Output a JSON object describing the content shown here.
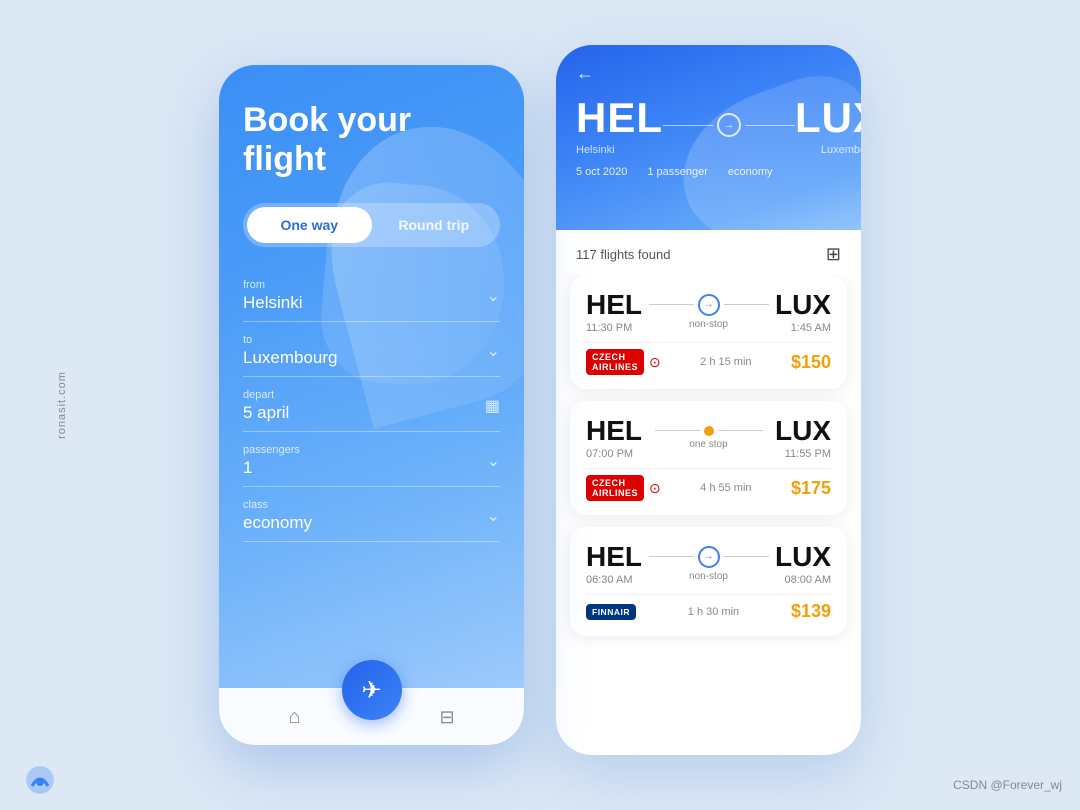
{
  "watermark": {
    "left": "ronasit.com",
    "bottom_right": "CSDN @Forever_wj"
  },
  "left_phone": {
    "title": "Book your\nflight",
    "toggle": {
      "one_way": "One way",
      "round_trip": "Round trip",
      "active": "one_way"
    },
    "fields": [
      {
        "label": "from",
        "value": "Helsinki",
        "icon": "chevron"
      },
      {
        "label": "to",
        "value": "Luxembourg",
        "icon": "chevron"
      },
      {
        "label": "depart",
        "value": "5 april",
        "icon": "calendar"
      },
      {
        "label": "passengers",
        "value": "1",
        "icon": "chevron"
      },
      {
        "label": "class",
        "value": "economy",
        "icon": "chevron"
      }
    ],
    "nav": {
      "home_icon": "⌂",
      "plane_icon": "✈",
      "bookmark_icon": "⊟"
    }
  },
  "right_phone": {
    "header": {
      "back": "←",
      "from_code": "HEL",
      "to_code": "LUX",
      "from_city": "Helsinki",
      "to_city": "Luxembourg",
      "date": "5 oct 2020",
      "passengers": "1 passenger",
      "class": "economy"
    },
    "flights_found": "117 flights found",
    "filter_icon": "⊞",
    "flights": [
      {
        "from_code": "HEL",
        "from_time": "11:30 PM",
        "to_code": "LUX",
        "to_time": "1:45 AM",
        "stop_type": "non-stop",
        "stop_style": "nonstop",
        "airline": "CZECH AIRLINES",
        "airline_style": "czech",
        "duration": "2 h 15 min",
        "price": "$150"
      },
      {
        "from_code": "HEL",
        "from_time": "07:00 PM",
        "to_code": "LUX",
        "to_time": "11:55 PM",
        "stop_type": "one stop",
        "stop_style": "onestop",
        "airline": "CZECH AIRLINES",
        "airline_style": "czech",
        "duration": "4 h 55 min",
        "price": "$175"
      },
      {
        "from_code": "HEL",
        "from_time": "06:30 AM",
        "to_code": "LUX",
        "to_time": "08:00 AM",
        "stop_type": "non-stop",
        "stop_style": "nonstop",
        "airline": "FINNAIR",
        "airline_style": "finnair",
        "duration": "1 h 30 min",
        "price": "$139"
      }
    ]
  }
}
